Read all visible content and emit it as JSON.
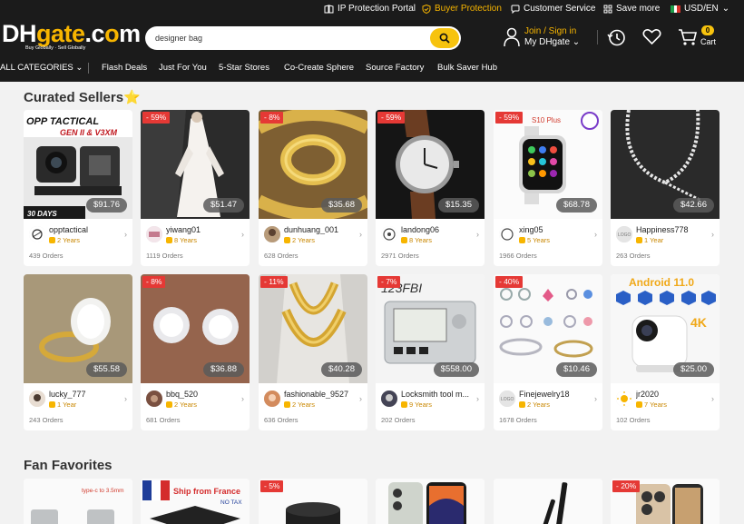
{
  "header": {
    "utility": {
      "ip_protection": "IP Protection Portal",
      "buyer_protection": "Buyer Protection",
      "customer_service": "Customer Service",
      "save_more": "Save more",
      "locale": "USD/EN"
    },
    "logo": {
      "main": "DHgate.com",
      "part1": "DH",
      "part2": "gate",
      "part3": ".c",
      "part4": "o",
      "part5": "m",
      "tagline": "Buy Globally · Sell Globally"
    },
    "search": {
      "value": "designer bag",
      "placeholder": "designer bag"
    },
    "account": {
      "join": "Join / Sign in",
      "my": "My DHgate"
    },
    "cart": {
      "count": "0",
      "label": "Cart"
    },
    "accent_color": "#f7c30e"
  },
  "nav": {
    "all_categories": "ALL CATEGORIES",
    "items": [
      "Flash Deals",
      "Just For You",
      "5-Star Stores",
      "Co-Create Sphere",
      "Source Factory",
      "Bulk Saver Hub"
    ]
  },
  "curated": {
    "title": "Curated Sellers⭐",
    "cards": [
      {
        "seller": "opptactical",
        "years": "2 Years",
        "orders": "439 Orders",
        "price": "$91.76",
        "discount": "",
        "overlay": [
          "OPP TACTICAL",
          "GEN II & V3XM",
          "30 DAYS"
        ]
      },
      {
        "seller": "yiwang01",
        "years": "8 Years",
        "orders": "1119 Orders",
        "price": "$51.47",
        "discount": "- 59%"
      },
      {
        "seller": "dunhuang_001",
        "years": "2 Years",
        "orders": "628 Orders",
        "price": "$35.68",
        "discount": "- 8%"
      },
      {
        "seller": "landong06",
        "years": "8 Years",
        "orders": "2971 Orders",
        "price": "$15.35",
        "discount": "- 59%"
      },
      {
        "seller": "xing05",
        "years": "5 Years",
        "orders": "1966 Orders",
        "price": "$68.78",
        "discount": "- 59%",
        "overlay": [
          "S10 Plus"
        ]
      },
      {
        "seller": "Happiness778",
        "years": "1 Year",
        "orders": "263 Orders",
        "price": "$42.66",
        "discount": ""
      },
      {
        "seller": "lucky_777",
        "years": "1 Year",
        "orders": "243 Orders",
        "price": "$55.58",
        "discount": ""
      },
      {
        "seller": "bbq_520",
        "years": "2 Years",
        "orders": "681 Orders",
        "price": "$36.88",
        "discount": "- 8%"
      },
      {
        "seller": "fashionable_9527",
        "years": "2 Years",
        "orders": "636 Orders",
        "price": "$40.28",
        "discount": "- 11%"
      },
      {
        "seller": "Locksmith tool m...",
        "years": "9 Years",
        "orders": "202 Orders",
        "price": "$558.00",
        "discount": "- 7%",
        "overlay": [
          "123FBI"
        ]
      },
      {
        "seller": "Finejewelry18",
        "years": "2 Years",
        "orders": "1678 Orders",
        "price": "$10.46",
        "discount": "- 40%"
      },
      {
        "seller": "jr2020",
        "years": "7 Years",
        "orders": "102 Orders",
        "price": "$25.00",
        "discount": "",
        "overlay": [
          "Android 11.0",
          "4K"
        ]
      }
    ]
  },
  "fan": {
    "title": "Fan Favorites",
    "cards": [
      {
        "discount": "",
        "overlay": "type-c to 3.5mm"
      },
      {
        "discount": "",
        "overlay": "Ship from France",
        "overlay2": "NO TAX"
      },
      {
        "discount": "- 5%",
        "overlay": ""
      },
      {
        "discount": "",
        "overlay": ""
      },
      {
        "discount": "",
        "overlay": ""
      },
      {
        "discount": "- 20%",
        "overlay": ""
      }
    ]
  }
}
